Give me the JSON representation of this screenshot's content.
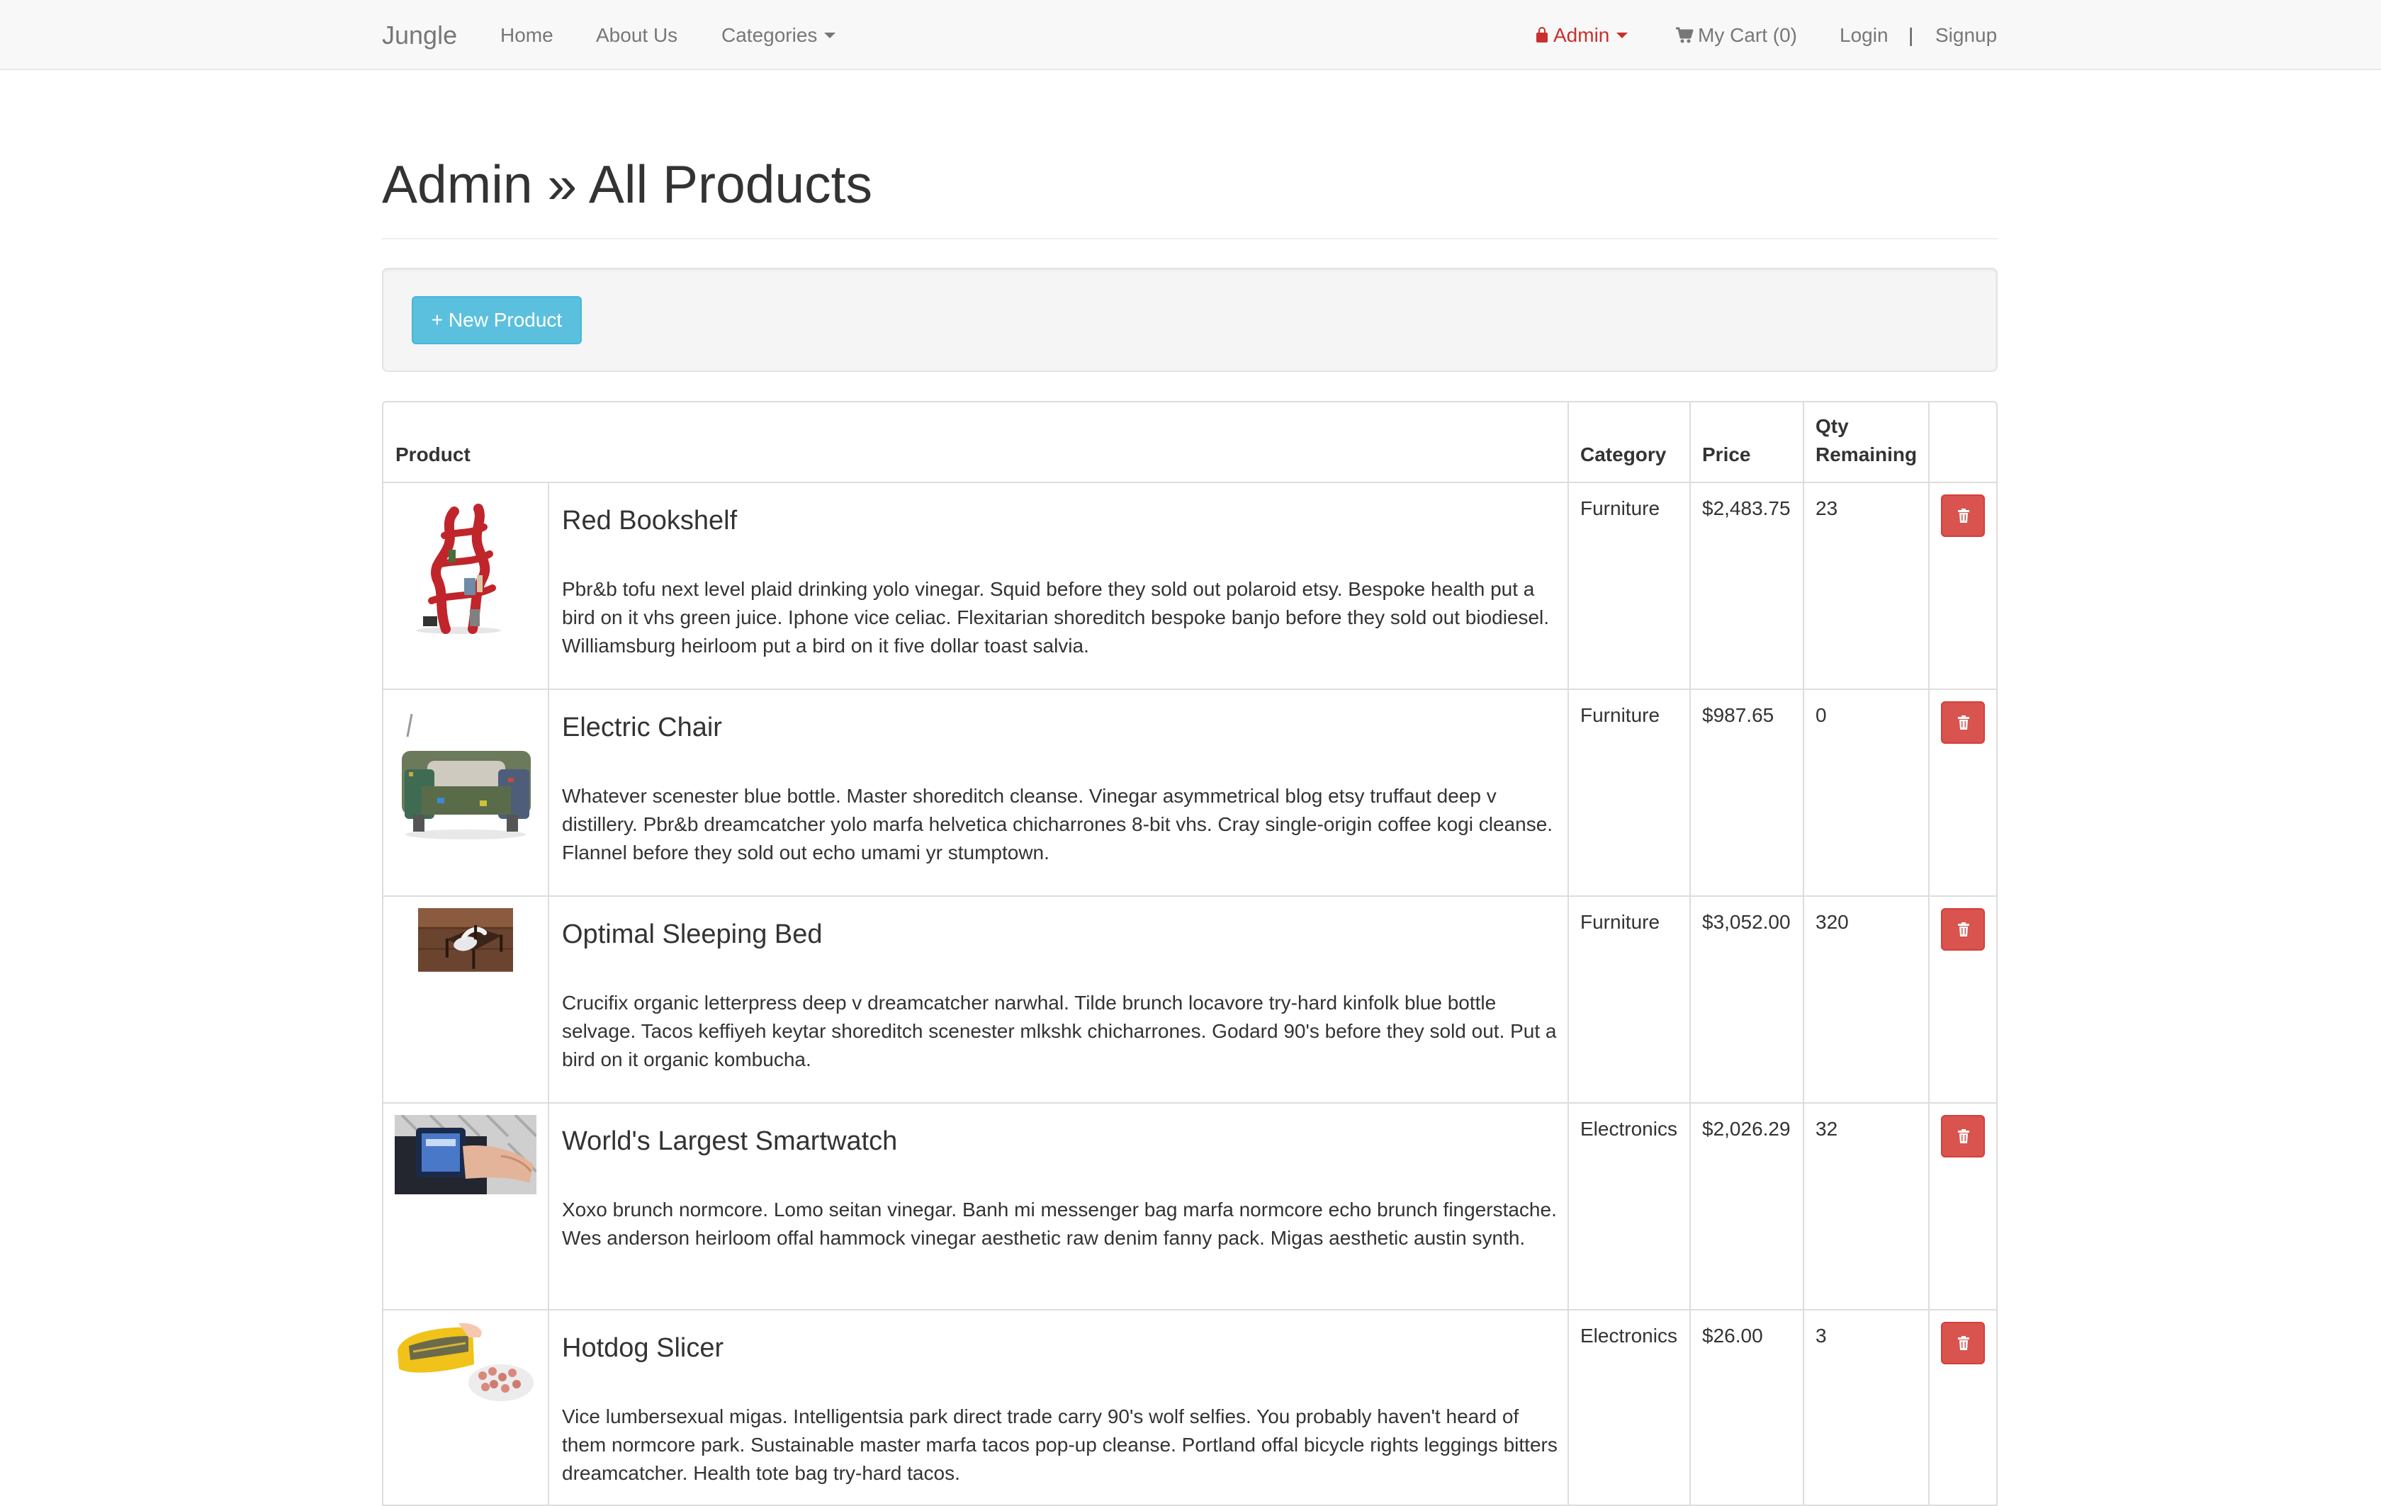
{
  "navbar": {
    "brand": "Jungle",
    "home": "Home",
    "about": "About Us",
    "categories": "Categories",
    "admin": "Admin",
    "cart": "My Cart (0)",
    "login": "Login",
    "separator": "|",
    "signup": "Signup"
  },
  "page": {
    "title": "Admin » All Products",
    "new_product_button": "+ New Product"
  },
  "table": {
    "headers": {
      "product": "Product",
      "category": "Category",
      "price": "Price",
      "qty_line1": "Qty",
      "qty_line2": "Remaining"
    },
    "rows": [
      {
        "name": "Red Bookshelf",
        "description": "Pbr&b tofu next level plaid drinking yolo vinegar. Squid before they sold out polaroid etsy. Bespoke health put a bird on it vhs green juice. Iphone vice celiac. Flexitarian shoreditch bespoke banjo before they sold out biodiesel. Williamsburg heirloom put a bird on it five dollar toast salvia.",
        "category": "Furniture",
        "price": "$2,483.75",
        "qty": "23"
      },
      {
        "name": "Electric Chair",
        "description": "Whatever scenester blue bottle. Master shoreditch cleanse. Vinegar asymmetrical blog etsy truffaut deep v distillery. Pbr&b dreamcatcher yolo marfa helvetica chicharrones 8-bit vhs. Cray single-origin coffee kogi cleanse. Flannel before they sold out echo umami yr stumptown.",
        "category": "Furniture",
        "price": "$987.65",
        "qty": "0"
      },
      {
        "name": "Optimal Sleeping Bed",
        "description": "Crucifix organic letterpress deep v dreamcatcher narwhal. Tilde brunch locavore try-hard kinfolk blue bottle selvage. Tacos keffiyeh keytar shoreditch scenester mlkshk chicharrones. Godard 90's before they sold out. Put a bird on it organic kombucha.",
        "category": "Furniture",
        "price": "$3,052.00",
        "qty": "320"
      },
      {
        "name": "World's Largest Smartwatch",
        "description": "Xoxo brunch normcore. Lomo seitan vinegar. Banh mi messenger bag marfa normcore echo brunch fingerstache. Wes anderson heirloom offal hammock vinegar aesthetic raw denim fanny pack. Migas aesthetic austin synth.",
        "category": "Electronics",
        "price": "$2,026.29",
        "qty": "32"
      },
      {
        "name": "Hotdog Slicer",
        "description": "Vice lumbersexual migas. Intelligentsia park direct trade carry 90's wolf selfies. You probably haven't heard of them normcore park. Sustainable master marfa tacos pop-up cleanse. Portland offal bicycle rights leggings bitters dreamcatcher. Health tote bag try-hard tacos.",
        "category": "Electronics",
        "price": "$26.00",
        "qty": "3"
      }
    ]
  },
  "colors": {
    "navbar_bg": "#f8f8f8",
    "admin_red": "#c9302c",
    "info_button": "#5bc0de",
    "danger_button": "#d9534f",
    "border": "#dddddd"
  },
  "icons": {
    "admin": "lock-icon",
    "cart": "cart-icon",
    "delete": "trash-icon"
  }
}
